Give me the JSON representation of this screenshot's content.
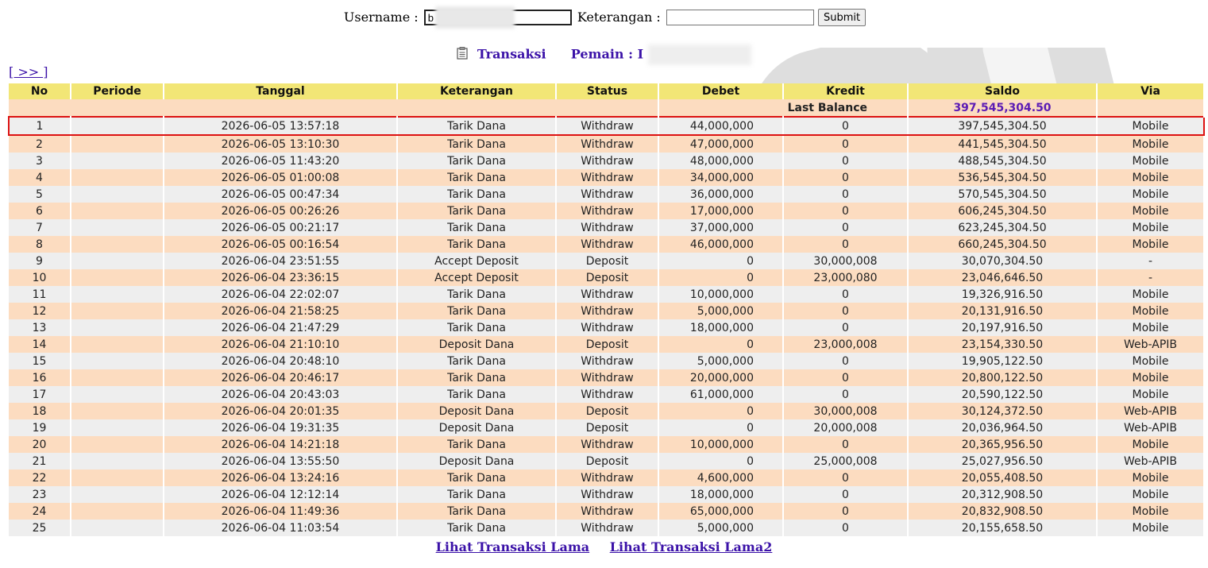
{
  "search": {
    "username_label": "Username :",
    "username_value": "b",
    "keterangan_label": "Keterangan :",
    "keterangan_value": "",
    "submit_label": "Submit"
  },
  "title": {
    "transaksi": "Transaksi",
    "pemain_label": "Pemain :",
    "pemain_value": "I"
  },
  "nav": {
    "next_link": "[ >> ]"
  },
  "table": {
    "headers": [
      "No",
      "Periode",
      "Tanggal",
      "Keterangan",
      "Status",
      "Debet",
      "Kredit",
      "Saldo",
      "Via"
    ],
    "last_balance_label": "Last Balance",
    "last_balance_value": "397,545,304.50",
    "rows": [
      {
        "no": "1",
        "periode": "",
        "tanggal": "2026-06-05 13:57:18",
        "keterangan": "Tarik Dana",
        "status": "Withdraw",
        "debet": "44,000,000",
        "kredit": "0",
        "saldo": "397,545,304.50",
        "via": "Mobile"
      },
      {
        "no": "2",
        "periode": "",
        "tanggal": "2026-06-05 13:10:30",
        "keterangan": "Tarik Dana",
        "status": "Withdraw",
        "debet": "47,000,000",
        "kredit": "0",
        "saldo": "441,545,304.50",
        "via": "Mobile"
      },
      {
        "no": "3",
        "periode": "",
        "tanggal": "2026-06-05 11:43:20",
        "keterangan": "Tarik Dana",
        "status": "Withdraw",
        "debet": "48,000,000",
        "kredit": "0",
        "saldo": "488,545,304.50",
        "via": "Mobile"
      },
      {
        "no": "4",
        "periode": "",
        "tanggal": "2026-06-05 01:00:08",
        "keterangan": "Tarik Dana",
        "status": "Withdraw",
        "debet": "34,000,000",
        "kredit": "0",
        "saldo": "536,545,304.50",
        "via": "Mobile"
      },
      {
        "no": "5",
        "periode": "",
        "tanggal": "2026-06-05 00:47:34",
        "keterangan": "Tarik Dana",
        "status": "Withdraw",
        "debet": "36,000,000",
        "kredit": "0",
        "saldo": "570,545,304.50",
        "via": "Mobile"
      },
      {
        "no": "6",
        "periode": "",
        "tanggal": "2026-06-05 00:26:26",
        "keterangan": "Tarik Dana",
        "status": "Withdraw",
        "debet": "17,000,000",
        "kredit": "0",
        "saldo": "606,245,304.50",
        "via": "Mobile"
      },
      {
        "no": "7",
        "periode": "",
        "tanggal": "2026-06-05 00:21:17",
        "keterangan": "Tarik Dana",
        "status": "Withdraw",
        "debet": "37,000,000",
        "kredit": "0",
        "saldo": "623,245,304.50",
        "via": "Mobile"
      },
      {
        "no": "8",
        "periode": "",
        "tanggal": "2026-06-05 00:16:54",
        "keterangan": "Tarik Dana",
        "status": "Withdraw",
        "debet": "46,000,000",
        "kredit": "0",
        "saldo": "660,245,304.50",
        "via": "Mobile"
      },
      {
        "no": "9",
        "periode": "",
        "tanggal": "2026-06-04 23:51:55",
        "keterangan": "Accept Deposit",
        "status": "Deposit",
        "debet": "0",
        "kredit": "30,000,008",
        "saldo": "30,070,304.50",
        "via": "-"
      },
      {
        "no": "10",
        "periode": "",
        "tanggal": "2026-06-04 23:36:15",
        "keterangan": "Accept Deposit",
        "status": "Deposit",
        "debet": "0",
        "kredit": "23,000,080",
        "saldo": "23,046,646.50",
        "via": "-"
      },
      {
        "no": "11",
        "periode": "",
        "tanggal": "2026-06-04 22:02:07",
        "keterangan": "Tarik Dana",
        "status": "Withdraw",
        "debet": "10,000,000",
        "kredit": "0",
        "saldo": "19,326,916.50",
        "via": "Mobile"
      },
      {
        "no": "12",
        "periode": "",
        "tanggal": "2026-06-04 21:58:25",
        "keterangan": "Tarik Dana",
        "status": "Withdraw",
        "debet": "5,000,000",
        "kredit": "0",
        "saldo": "20,131,916.50",
        "via": "Mobile"
      },
      {
        "no": "13",
        "periode": "",
        "tanggal": "2026-06-04 21:47:29",
        "keterangan": "Tarik Dana",
        "status": "Withdraw",
        "debet": "18,000,000",
        "kredit": "0",
        "saldo": "20,197,916.50",
        "via": "Mobile"
      },
      {
        "no": "14",
        "periode": "",
        "tanggal": "2026-06-04 21:10:10",
        "keterangan": "Deposit Dana",
        "status": "Deposit",
        "debet": "0",
        "kredit": "23,000,008",
        "saldo": "23,154,330.50",
        "via": "Web-APIB"
      },
      {
        "no": "15",
        "periode": "",
        "tanggal": "2026-06-04 20:48:10",
        "keterangan": "Tarik Dana",
        "status": "Withdraw",
        "debet": "5,000,000",
        "kredit": "0",
        "saldo": "19,905,122.50",
        "via": "Mobile"
      },
      {
        "no": "16",
        "periode": "",
        "tanggal": "2026-06-04 20:46:17",
        "keterangan": "Tarik Dana",
        "status": "Withdraw",
        "debet": "20,000,000",
        "kredit": "0",
        "saldo": "20,800,122.50",
        "via": "Mobile"
      },
      {
        "no": "17",
        "periode": "",
        "tanggal": "2026-06-04 20:43:03",
        "keterangan": "Tarik Dana",
        "status": "Withdraw",
        "debet": "61,000,000",
        "kredit": "0",
        "saldo": "20,590,122.50",
        "via": "Mobile"
      },
      {
        "no": "18",
        "periode": "",
        "tanggal": "2026-06-04 20:01:35",
        "keterangan": "Deposit Dana",
        "status": "Deposit",
        "debet": "0",
        "kredit": "30,000,008",
        "saldo": "30,124,372.50",
        "via": "Web-APIB"
      },
      {
        "no": "19",
        "periode": "",
        "tanggal": "2026-06-04 19:31:35",
        "keterangan": "Deposit Dana",
        "status": "Deposit",
        "debet": "0",
        "kredit": "20,000,008",
        "saldo": "20,036,964.50",
        "via": "Web-APIB"
      },
      {
        "no": "20",
        "periode": "",
        "tanggal": "2026-06-04 14:21:18",
        "keterangan": "Tarik Dana",
        "status": "Withdraw",
        "debet": "10,000,000",
        "kredit": "0",
        "saldo": "20,365,956.50",
        "via": "Mobile"
      },
      {
        "no": "21",
        "periode": "",
        "tanggal": "2026-06-04 13:55:50",
        "keterangan": "Deposit Dana",
        "status": "Deposit",
        "debet": "0",
        "kredit": "25,000,008",
        "saldo": "25,027,956.50",
        "via": "Web-APIB"
      },
      {
        "no": "22",
        "periode": "",
        "tanggal": "2026-06-04 13:24:16",
        "keterangan": "Tarik Dana",
        "status": "Withdraw",
        "debet": "4,600,000",
        "kredit": "0",
        "saldo": "20,055,408.50",
        "via": "Mobile"
      },
      {
        "no": "23",
        "periode": "",
        "tanggal": "2026-06-04 12:12:14",
        "keterangan": "Tarik Dana",
        "status": "Withdraw",
        "debet": "18,000,000",
        "kredit": "0",
        "saldo": "20,312,908.50",
        "via": "Mobile"
      },
      {
        "no": "24",
        "periode": "",
        "tanggal": "2026-06-04 11:49:36",
        "keterangan": "Tarik Dana",
        "status": "Withdraw",
        "debet": "65,000,000",
        "kredit": "0",
        "saldo": "20,832,908.50",
        "via": "Mobile"
      },
      {
        "no": "25",
        "periode": "",
        "tanggal": "2026-06-04 11:03:54",
        "keterangan": "Tarik Dana",
        "status": "Withdraw",
        "debet": "5,000,000",
        "kredit": "0",
        "saldo": "20,155,658.50",
        "via": "Mobile"
      }
    ]
  },
  "footer": {
    "link1": "Lihat Transaksi Lama",
    "link2": "Lihat Transaksi Lama2"
  },
  "colors": {
    "header_bg": "#f2e676",
    "row_odd": "#eeeeee",
    "row_even": "#fcdcc0",
    "status": "#d02040",
    "link": "#3b12a8",
    "highlight_border": "#d11111"
  }
}
